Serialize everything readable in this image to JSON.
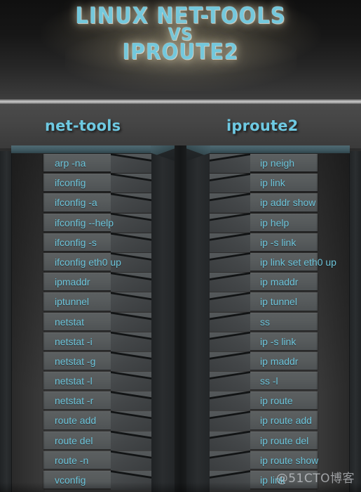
{
  "poster": {
    "title_line1": "LINUX NET-TOOLS",
    "title_line2": "VS",
    "title_line3": "IPROUTE2",
    "watermark": "@51CTO博客",
    "accent_color": "#6cc4da",
    "title_color": "#74c8dc",
    "header_color": "#6ec9e2",
    "background_color": "#2e2e2e",
    "bar_color": "#585c5d"
  },
  "columns": [
    {
      "header": "net-tools",
      "rows": [
        "arp -na",
        "ifconfig",
        "ifconfig -a",
        "ifconfig --help",
        "ifconfig -s",
        "ifconfig eth0 up",
        "ipmaddr",
        "iptunnel",
        "netstat",
        "netstat -i",
        "netstat  -g",
        "netstat -l",
        "netstat -r",
        "route add",
        "route del",
        "route -n",
        "vconfig"
      ]
    },
    {
      "header": "iproute2",
      "rows": [
        "ip neigh",
        "ip link",
        "ip addr show",
        "ip help",
        "ip -s link",
        "ip link set eth0 up",
        "ip maddr",
        "ip tunnel",
        "ss",
        "ip -s link",
        "ip maddr",
        "ss -l",
        "ip route",
        "ip route add",
        "ip route del",
        "ip route show",
        "ip link"
      ]
    }
  ]
}
